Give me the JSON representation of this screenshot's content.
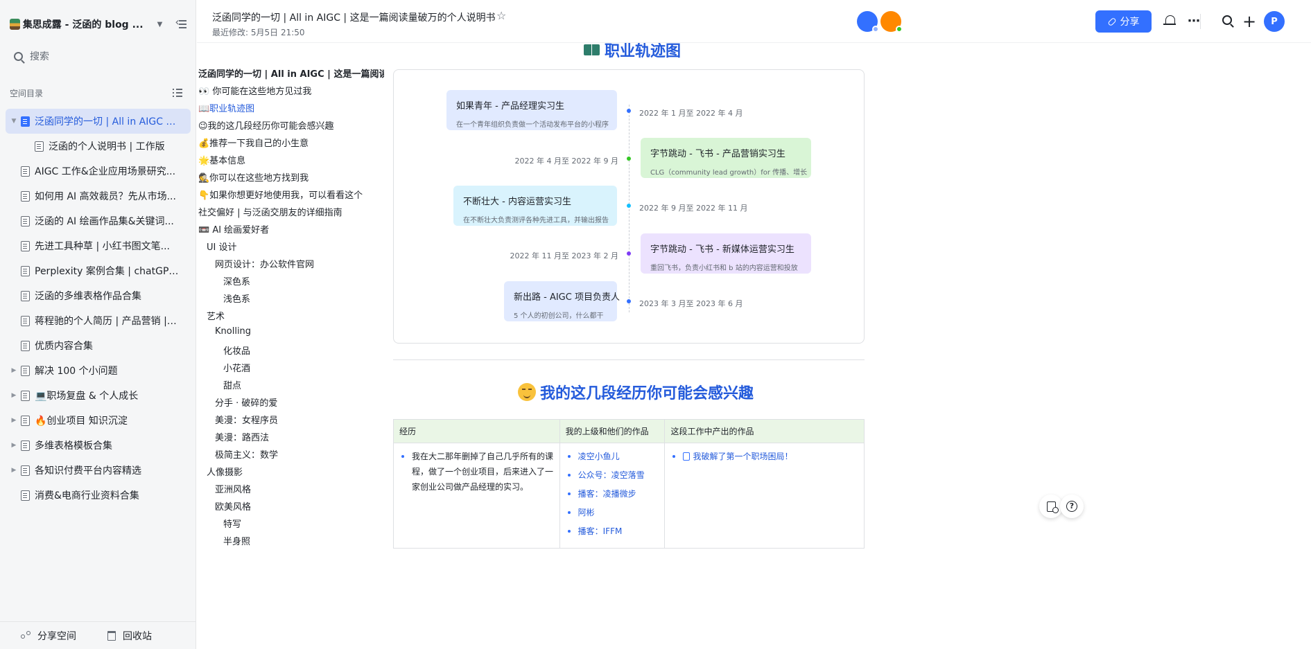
{
  "sidebar": {
    "space_title": "集思成露 - 泛函的 blog ...",
    "search_placeholder": "搜索",
    "dir_label": "空间目录",
    "items": [
      {
        "label": "泛函同学的一切 | All in AIGC | ...",
        "expanded": true,
        "active": true,
        "level": 0
      },
      {
        "label": "泛函的个人说明书 | 工作版",
        "level": 1
      },
      {
        "label": "AIGC 工作&企业应用场景研究...",
        "level": 0
      },
      {
        "label": "如何用 AI 高效裁员？先从市场...",
        "level": 0
      },
      {
        "label": "泛函的 AI 绘画作品集&关键词...",
        "level": 0
      },
      {
        "label": "先进工具种草 | 小红书图文笔...",
        "level": 0
      },
      {
        "label": "Perplexity 案例合集 | chatGPT ...",
        "level": 0
      },
      {
        "label": "泛函的多维表格作品合集",
        "level": 0
      },
      {
        "label": "蒋程驰的个人简历 | 产品营销 | ...",
        "level": 0
      },
      {
        "label": "优质内容合集",
        "level": 0
      },
      {
        "label": "解决 100 个小问题",
        "collapsed": true,
        "level": 0
      },
      {
        "label": "💻职场复盘 & 个人成长",
        "collapsed": true,
        "level": 0
      },
      {
        "label": "🔥创业项目 知识沉淀",
        "collapsed": true,
        "level": 0
      },
      {
        "label": "多维表格模板合集",
        "collapsed": true,
        "level": 0
      },
      {
        "label": "各知识付费平台内容精选",
        "collapsed": true,
        "level": 0
      },
      {
        "label": "消费&电商行业资料合集",
        "level": 0
      }
    ],
    "share_space": "分享空间",
    "recycle_bin": "回收站"
  },
  "header": {
    "title": "泛函同学的一切 | All in AIGC | 这是一篇阅读量破万的个人说明书",
    "last_modified": "最近修改: 5月5日 21:50",
    "share_button": "分享",
    "user_initial": "P",
    "accent": "#3370ff"
  },
  "outline": {
    "items": [
      {
        "label": "泛函同学的一切 | All in AIGC | 这是一篇阅读...",
        "indent": 0,
        "bold": true
      },
      {
        "label": "👀 你可能在这些地方见过我",
        "indent": 0
      },
      {
        "label": "📖职业轨迹图",
        "indent": 0,
        "active": true
      },
      {
        "label": "😉我的这几段经历你可能会感兴趣",
        "indent": 0
      },
      {
        "label": "💰推荐一下我自己的小生意",
        "indent": 0
      },
      {
        "label": "🌟基本信息",
        "indent": 0
      },
      {
        "label": "🕵你可以在这些地方找到我",
        "indent": 0
      },
      {
        "label": "👇如果你想更好地使用我，可以看看这个",
        "indent": 0
      },
      {
        "label": "社交偏好 | 与泛函交朋友的详细指南",
        "indent": 0
      },
      {
        "label": "📼 AI 绘画爱好者",
        "indent": 0
      },
      {
        "label": "UI 设计",
        "indent": 1
      },
      {
        "label": "网页设计：办公软件官网",
        "indent": 2
      },
      {
        "label": "深色系",
        "indent": 3
      },
      {
        "label": "浅色系",
        "indent": 3
      },
      {
        "label": "艺术",
        "indent": 1
      },
      {
        "label": "Knolling",
        "indent": 2
      },
      {
        "label": "化妆品",
        "indent": 3
      },
      {
        "label": "小花酒",
        "indent": 3
      },
      {
        "label": "甜点",
        "indent": 3
      },
      {
        "label": "分手 · 破碎的爱",
        "indent": 2
      },
      {
        "label": "美漫：女程序员",
        "indent": 2
      },
      {
        "label": "美漫：路西法",
        "indent": 2
      },
      {
        "label": "极简主义：数学",
        "indent": 2
      },
      {
        "label": "人像摄影",
        "indent": 1
      },
      {
        "label": "亚洲风格",
        "indent": 2
      },
      {
        "label": "欧美风格",
        "indent": 2
      },
      {
        "label": "特写",
        "indent": 3
      },
      {
        "label": "半身照",
        "indent": 3
      }
    ]
  },
  "main": {
    "career_heading": "职业轨迹图",
    "timeline": [
      {
        "title": "如果青年 - 产品经理实习生",
        "desc": "在一个青年组织负责做一个活动发布平台的小程序",
        "date": "2022 年 1 月至 2022 年 4 月",
        "side": "left",
        "bg": "#e1eaff",
        "dot": "#3370ff"
      },
      {
        "title": "字节跳动 - 飞书 - 产品营销实习生",
        "desc": "CLG（community lead growth）for 传播、增长",
        "date": "2022 年 4 月至 2022 年 9 月",
        "side": "right",
        "bg": "#d9f5d6",
        "dot": "#34c724"
      },
      {
        "title": "不断壮大 - 内容运营实习生",
        "desc": "在不断壮大负责测评各种先进工具，并输出报告",
        "date": "2022 年 9 月至 2022 年 11 月",
        "side": "left",
        "bg": "#d9f3fd",
        "dot": "#14c0ff"
      },
      {
        "title": "字节跳动 - 飞书 - 新媒体运营实习生",
        "desc": "重回飞书，负责小红书和 b 站的内容运营和投放",
        "date": "2022 年 11 月至 2023 年 2 月",
        "side": "right",
        "bg": "#ece2fe",
        "dot": "#7f3bf5"
      },
      {
        "title": "新出路 - AIGC 项目负责人",
        "desc": "5 个人的初创公司，什么都干",
        "date": "2023 年 3 月至 2023 年 6 月",
        "side": "left",
        "bg": "#e1eaff",
        "dot": "#3370ff"
      }
    ],
    "exp_heading": "我的这几段经历你可能会感兴趣",
    "table": {
      "headers": [
        "经历",
        "我的上级和他们的作品",
        "这段工作中产出的作品"
      ],
      "row1": {
        "experience": "我在大二那年删掉了自己几乎所有的课程，做了一个创业项目，后来进入了一家创业公司做产品经理的实习。",
        "superiors": [
          "凌空小鱼儿",
          "公众号：凌空落雪",
          "播客：凌播微步",
          "阿彬",
          "播客：IFFM"
        ],
        "works": [
          "我破解了第一个职场困局！"
        ]
      }
    }
  }
}
